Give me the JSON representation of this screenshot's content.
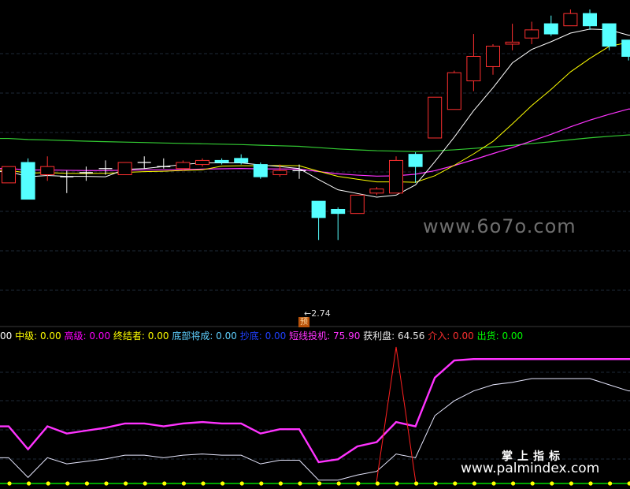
{
  "chart_data": {
    "type": "candlestick",
    "price_axis": {
      "min": 2.55,
      "max": 4.05
    },
    "candles": [
      {
        "o": 3.2,
        "c": 3.28,
        "h": 3.28,
        "l": 3.2
      },
      {
        "o": 3.3,
        "c": 3.12,
        "h": 3.32,
        "l": 3.12
      },
      {
        "o": 3.24,
        "c": 3.28,
        "h": 3.33,
        "l": 3.21
      },
      {
        "o": 3.23,
        "c": 3.23,
        "h": 3.26,
        "l": 3.15
      },
      {
        "o": 3.25,
        "c": 3.25,
        "h": 3.28,
        "l": 3.21
      },
      {
        "o": 3.27,
        "c": 3.27,
        "h": 3.31,
        "l": 3.24
      },
      {
        "o": 3.24,
        "c": 3.3,
        "h": 3.3,
        "l": 3.24
      },
      {
        "o": 3.3,
        "c": 3.3,
        "h": 3.33,
        "l": 3.27
      },
      {
        "o": 3.28,
        "c": 3.28,
        "h": 3.32,
        "l": 3.27
      },
      {
        "o": 3.27,
        "c": 3.3,
        "h": 3.31,
        "l": 3.26
      },
      {
        "o": 3.29,
        "c": 3.31,
        "h": 3.32,
        "l": 3.28
      },
      {
        "o": 3.31,
        "c": 3.3,
        "h": 3.32,
        "l": 3.29
      },
      {
        "o": 3.32,
        "c": 3.3,
        "h": 3.34,
        "l": 3.29
      },
      {
        "o": 3.29,
        "c": 3.23,
        "h": 3.3,
        "l": 3.22
      },
      {
        "o": 3.24,
        "c": 3.26,
        "h": 3.29,
        "l": 3.23
      },
      {
        "o": 3.26,
        "c": 3.26,
        "h": 3.29,
        "l": 3.22
      },
      {
        "o": 3.11,
        "c": 3.03,
        "h": 3.11,
        "l": 2.92
      },
      {
        "o": 3.07,
        "c": 3.05,
        "h": 3.08,
        "l": 2.92
      },
      {
        "o": 3.05,
        "c": 3.14,
        "h": 3.14,
        "l": 3.05
      },
      {
        "o": 3.15,
        "c": 3.17,
        "h": 3.18,
        "l": 3.14
      },
      {
        "o": 3.15,
        "c": 3.31,
        "h": 3.33,
        "l": 3.15
      },
      {
        "o": 3.34,
        "c": 3.28,
        "h": 3.35,
        "l": 3.2
      },
      {
        "o": 3.42,
        "c": 3.62,
        "h": 3.62,
        "l": 3.42
      },
      {
        "o": 3.56,
        "c": 3.74,
        "h": 3.75,
        "l": 3.56
      },
      {
        "o": 3.7,
        "c": 3.82,
        "h": 3.93,
        "l": 3.65
      },
      {
        "o": 3.77,
        "c": 3.87,
        "h": 3.88,
        "l": 3.73
      },
      {
        "o": 3.88,
        "c": 3.89,
        "h": 3.98,
        "l": 3.85
      },
      {
        "o": 3.91,
        "c": 3.95,
        "h": 3.99,
        "l": 3.88
      },
      {
        "o": 3.98,
        "c": 3.93,
        "h": 4.02,
        "l": 3.92
      },
      {
        "o": 3.97,
        "c": 4.03,
        "h": 4.05,
        "l": 3.97
      },
      {
        "o": 4.03,
        "c": 3.97,
        "h": 4.05,
        "l": 3.95
      },
      {
        "o": 3.98,
        "c": 3.87,
        "h": 3.98,
        "l": 3.85
      },
      {
        "o": 3.9,
        "c": 3.82,
        "h": 3.9,
        "l": 3.8
      }
    ],
    "annotation_low": "2.74",
    "signal_badge": "预"
  },
  "indicator_bar": [
    {
      "text": "00",
      "color": "#ffffff"
    },
    {
      "text": " 中级: 0.00",
      "color": "#ffff00"
    },
    {
      "text": " 高级: 0.00",
      "color": "#ff00ff"
    },
    {
      "text": " 终结者: 0.00",
      "color": "#ffff00"
    },
    {
      "text": " 底部将成: 0.00",
      "color": "#5fd0ff"
    },
    {
      "text": " 抄底: 0.00",
      "color": "#2040ff"
    },
    {
      "text": " 短线投机: 75.90",
      "color": "#ff33ff"
    },
    {
      "text": " 获利盘: 64.56",
      "color": "#e8e8e8"
    },
    {
      "text": " 介入: 0.00",
      "color": "#ff3030"
    },
    {
      "text": " 出货: 0.00",
      "color": "#00ff00"
    }
  ],
  "watermarks": {
    "site": "www.6o7o.com",
    "brand_cn": "掌上指标",
    "brand_url": "www.palmindex.com"
  },
  "colors": {
    "background": "#000000",
    "up": "#ff3030",
    "down": "#55ffff",
    "ma_white": "#ffffff",
    "ma_yellow": "#ffff00",
    "ma_magenta": "#ff33ff",
    "ma_green": "#33cc33"
  }
}
